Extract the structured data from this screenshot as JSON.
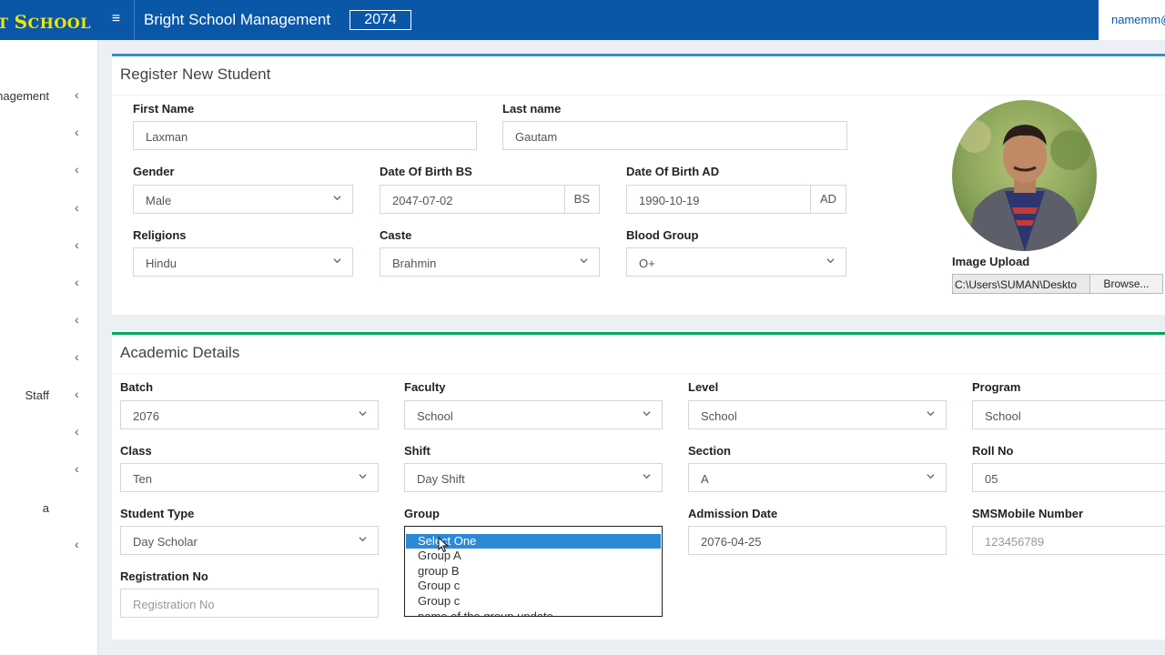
{
  "brand": {
    "text_prefix": "GHT ",
    "text_s": "S",
    "text_rest": "CHOOL"
  },
  "navbar": {
    "menu_icon": "≡",
    "title": "Bright School Management",
    "year": "2074",
    "user_email": "namemm@"
  },
  "sidebar": {
    "items": [
      {
        "label": "nagement"
      },
      {
        "label": ""
      },
      {
        "label": ""
      },
      {
        "label": ""
      },
      {
        "label": ""
      },
      {
        "label": ""
      },
      {
        "label": ""
      },
      {
        "label": ""
      },
      {
        "label": "Staff"
      },
      {
        "label": ""
      },
      {
        "label": ""
      },
      {
        "label": "a"
      },
      {
        "label": ""
      }
    ],
    "chevron": "‹"
  },
  "register": {
    "title": "Register New Student",
    "first_name": {
      "label": "First Name",
      "value": "Laxman"
    },
    "last_name": {
      "label": "Last name",
      "value": "Gautam"
    },
    "gender": {
      "label": "Gender",
      "value": "Male"
    },
    "dob_bs": {
      "label": "Date Of Birth BS",
      "value": "2047-07-02",
      "addon": "BS"
    },
    "dob_ad": {
      "label": "Date Of Birth AD",
      "value": "1990-10-19",
      "addon": "AD"
    },
    "religions": {
      "label": "Religions",
      "value": "Hindu"
    },
    "caste": {
      "label": "Caste",
      "value": "Brahmin"
    },
    "blood_group": {
      "label": "Blood Group",
      "value": "O+"
    },
    "image_upload": {
      "label": "Image Upload",
      "path": "C:\\Users\\SUMAN\\Deskto",
      "button": "Browse..."
    }
  },
  "academic": {
    "title": "Academic Details",
    "batch": {
      "label": "Batch",
      "value": "2076"
    },
    "faculty": {
      "label": "Faculty",
      "value": "School"
    },
    "level": {
      "label": "Level",
      "value": "School"
    },
    "program": {
      "label": "Program",
      "value": "School"
    },
    "class": {
      "label": "Class",
      "value": "Ten"
    },
    "shift": {
      "label": "Shift",
      "value": "Day Shift"
    },
    "section": {
      "label": "Section",
      "value": "A"
    },
    "roll_no": {
      "label": "Roll No",
      "value": "05"
    },
    "student_type": {
      "label": "Student Type",
      "value": "Day Scholar"
    },
    "group": {
      "label": "Group",
      "options": [
        "Select One",
        "Group A",
        "group B",
        "Group c",
        "Group c",
        "name of the group update"
      ],
      "selected_index": 0
    },
    "admission_date": {
      "label": "Admission Date",
      "value": "2076-04-25"
    },
    "sms_mobile": {
      "label": "SMSMobile Number",
      "placeholder": "123456789"
    },
    "registration_no": {
      "label": "Registration No",
      "placeholder": "Registration No"
    }
  },
  "colors": {
    "navbar": "#0a57a8",
    "brand_text": "#f2e600",
    "panel1_accent": "#3c8dbc",
    "panel2_accent": "#00a65a",
    "listbox_selected": "#2c89d6"
  }
}
